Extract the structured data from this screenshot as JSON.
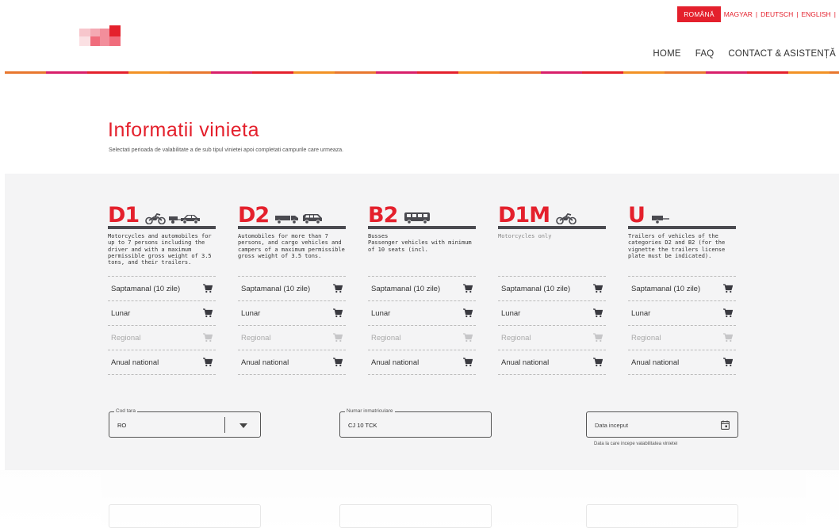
{
  "colors": {
    "accent": "#e4202c",
    "panel": "#f4f4f5",
    "dark": "#4a4a50"
  },
  "languages": {
    "active": "ROMÂNĂ",
    "others": [
      "MAGYAR",
      "DEUTSCH",
      "ENGLISH"
    ]
  },
  "nav": [
    "HOME",
    "FAQ",
    "CONTACT & ASISTENȚĂ"
  ],
  "heading": {
    "title": "Informatii vinieta",
    "subtitle": "Selectati perioada de valabilitate a de sub tipul vinietei apoi completati campurile care urmeaza."
  },
  "categories": [
    {
      "code": "D1",
      "icons": [
        "motorcycle-icon",
        "car-with-trailer-icon"
      ],
      "description": "Motorcycles and automobiles for up to 7 persons including the driver and with a maximum permissible gross weight of 3.5 tons, and their trailers.",
      "muted": false
    },
    {
      "code": "D2",
      "icons": [
        "truck-icon",
        "van-icon"
      ],
      "description": "Automobiles for more than 7 persons, and cargo vehicles and campers of a maximum permissible gross weight of 3.5 tons.",
      "muted": false
    },
    {
      "code": "B2",
      "icons": [
        "bus-icon"
      ],
      "description": "Busses\nPassenger vehicles with minimum of 10 seats (incl.",
      "muted": false
    },
    {
      "code": "D1M",
      "icons": [
        "motorcycle-icon"
      ],
      "description": "Motorcycles only",
      "muted": true
    },
    {
      "code": "U",
      "icons": [
        "trailer-icon"
      ],
      "description": "Trailers of vehicles of the categories D2 and B2 (for the vignette the trailers license plate must be indicated).",
      "muted": false
    }
  ],
  "options": [
    {
      "label": "Saptamanal (10 zile)",
      "disabled": false
    },
    {
      "label": "Lunar",
      "disabled": false
    },
    {
      "label": "Regional",
      "disabled": true
    },
    {
      "label": "Anual national",
      "disabled": false
    }
  ],
  "form": {
    "country": {
      "legend": "Cod tara",
      "value": "RO"
    },
    "plate": {
      "legend": "Numar inmatriculare",
      "value": "CJ 10 TCK"
    },
    "start_date": {
      "placeholder": "Data inceput",
      "hint": "Data la care incepe valabilitatea vinietei"
    }
  }
}
